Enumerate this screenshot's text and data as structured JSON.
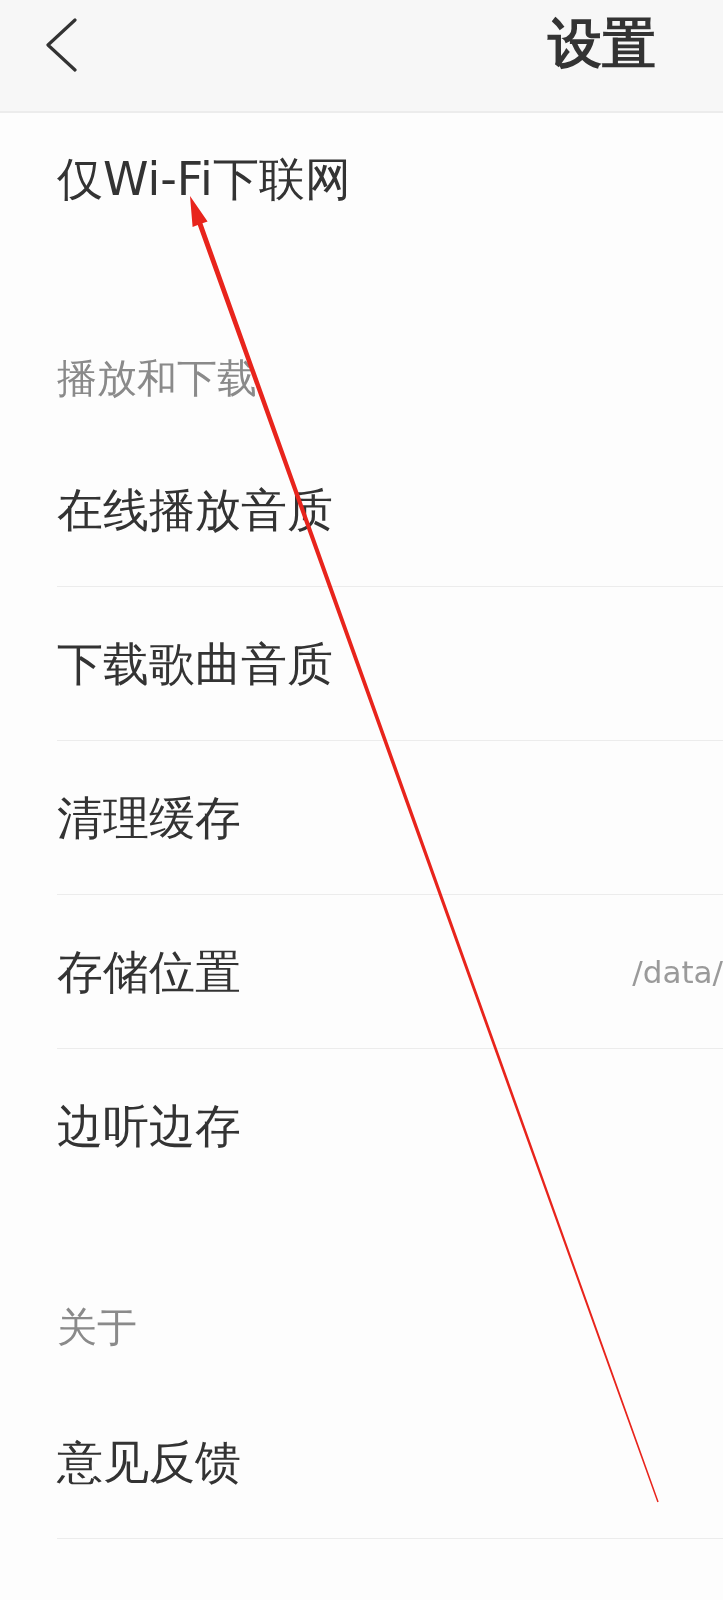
{
  "header": {
    "title": "设置"
  },
  "sections": [
    {
      "items": [
        {
          "label": "仅Wi-Fi下联网",
          "divider": false
        }
      ]
    },
    {
      "title": "播放和下载",
      "items": [
        {
          "label": "在线播放音质",
          "divider": true
        },
        {
          "label": "下载歌曲音质",
          "divider": true
        },
        {
          "label": "清理缓存",
          "divider": true
        },
        {
          "label": "存储位置",
          "value": "/data/",
          "divider": true
        },
        {
          "label": "边听边存",
          "divider": false
        }
      ]
    },
    {
      "title": "关于",
      "items": [
        {
          "label": "意见反馈",
          "divider": true
        }
      ]
    }
  ]
}
